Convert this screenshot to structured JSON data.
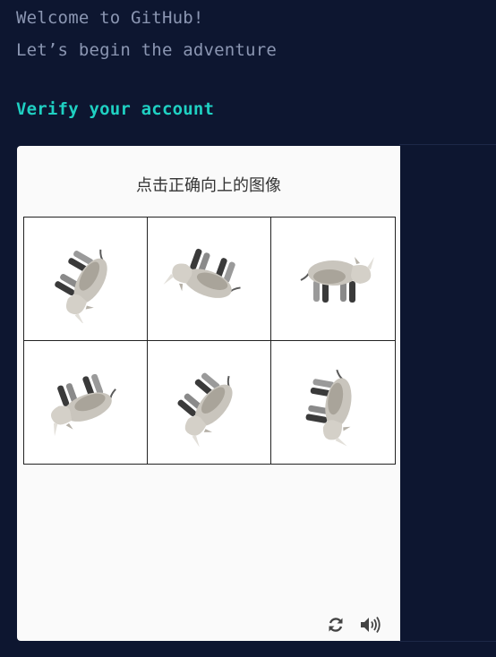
{
  "terminal": {
    "line1": "Welcome to GitHub!",
    "line2": "Let’s begin the adventure",
    "line3": "Verify your account"
  },
  "captcha": {
    "prompt": "点击正确向上的图像",
    "tiles": [
      {
        "animal": "rhino",
        "rotation_deg": 120
      },
      {
        "animal": "rhino",
        "rotation_deg": 200
      },
      {
        "animal": "rhino",
        "rotation_deg": 0
      },
      {
        "animal": "rhino",
        "rotation_deg": 160
      },
      {
        "animal": "rhino",
        "rotation_deg": 130
      },
      {
        "animal": "rhino",
        "rotation_deg": 100
      }
    ],
    "controls": [
      "refresh-icon",
      "audio-icon"
    ]
  },
  "colors": {
    "background": "#0d1630",
    "text": "#8b96b2",
    "accent": "#1fd0c2",
    "panel": "#fafafa"
  }
}
